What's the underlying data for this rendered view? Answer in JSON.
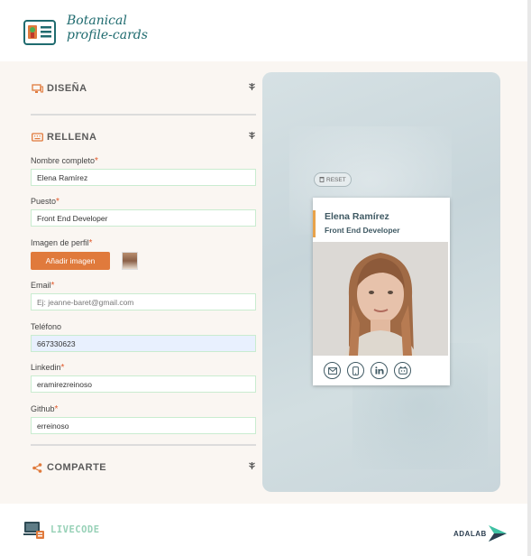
{
  "header": {
    "logo_line1": "Botanical",
    "logo_line2": "profile-cards",
    "logo_icon": "card-icon"
  },
  "sections": {
    "design": {
      "title": "DISEÑA",
      "icon": "monitor-icon",
      "chevron_icon": "leaf-chevron-icon"
    },
    "fill": {
      "title": "RELLENA",
      "icon": "keyboard-icon",
      "chevron_icon": "leaf-chevron-icon"
    },
    "share": {
      "title": "COMPARTE",
      "icon": "share-icon",
      "chevron_icon": "leaf-chevron-icon"
    }
  },
  "form": {
    "name": {
      "label": "Nombre completo",
      "required": "*",
      "value": "Elena Ramírez",
      "placeholder": ""
    },
    "job": {
      "label": "Puesto",
      "required": "*",
      "value": "Front End Developer",
      "placeholder": ""
    },
    "image": {
      "label": "Imagen de perfil",
      "required": "*",
      "button": "Añadir imagen"
    },
    "email": {
      "label": "Email",
      "required": "*",
      "value": "",
      "placeholder": "Ej: jeanne-baret@gmail.com"
    },
    "phone": {
      "label": "Teléfono",
      "required": "",
      "value": "667330623",
      "placeholder": ""
    },
    "linkedin": {
      "label": "Linkedin",
      "required": "*",
      "value": "eramirezreinoso",
      "placeholder": ""
    },
    "github": {
      "label": "Github",
      "required": "*",
      "value": "erreinoso",
      "placeholder": ""
    }
  },
  "preview": {
    "reset_label": "RESET",
    "card": {
      "name": "Elena Ramírez",
      "job": "Front End Developer",
      "social_icons": [
        "mail-icon",
        "phone-icon",
        "linkedin-icon",
        "github-icon"
      ]
    }
  },
  "footer": {
    "livecode_text": "LIVECODE",
    "adalab_text": "ADALAB"
  },
  "colors": {
    "accent_orange": "#e07a3c",
    "brand_teal": "#1f6b6f",
    "card_text": "#3f5963",
    "input_border": "#c9ecd0",
    "livecode_green": "#97d1b7"
  }
}
